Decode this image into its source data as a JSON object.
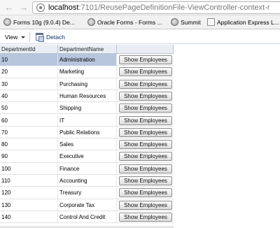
{
  "browser": {
    "url_host": "localhost",
    "url_rest": ":7101/ReusePageDefinitionFile-ViewController-context-r"
  },
  "bookmarks": [
    {
      "label": "Forms 10g (9.0.4) De...",
      "icon": "globe-icon"
    },
    {
      "label": "Oracle Forms - Forms ...",
      "icon": "globe-icon"
    },
    {
      "label": "Summit",
      "icon": "globe-icon"
    },
    {
      "label": "Application Express L...",
      "icon": "document-icon"
    }
  ],
  "toolbar": {
    "view_label": "View",
    "detach_label": "Detach"
  },
  "table": {
    "columns": [
      "DepartmentId",
      "DepartmentName",
      ""
    ],
    "button_label": "Show Employees",
    "selected_index": 0,
    "rows": [
      {
        "id": "10",
        "name": "Administration"
      },
      {
        "id": "20",
        "name": "Marketing"
      },
      {
        "id": "30",
        "name": "Purchasing"
      },
      {
        "id": "40",
        "name": "Human Resources"
      },
      {
        "id": "50",
        "name": "Shipping"
      },
      {
        "id": "60",
        "name": "IT"
      },
      {
        "id": "70",
        "name": "Public Relations"
      },
      {
        "id": "80",
        "name": "Sales"
      },
      {
        "id": "90",
        "name": "Executive"
      },
      {
        "id": "100",
        "name": "Finance"
      },
      {
        "id": "110",
        "name": "Accounting"
      },
      {
        "id": "120",
        "name": "Treasury"
      },
      {
        "id": "130",
        "name": "Corporate Tax"
      },
      {
        "id": "140",
        "name": "Control And Credit"
      }
    ]
  }
}
